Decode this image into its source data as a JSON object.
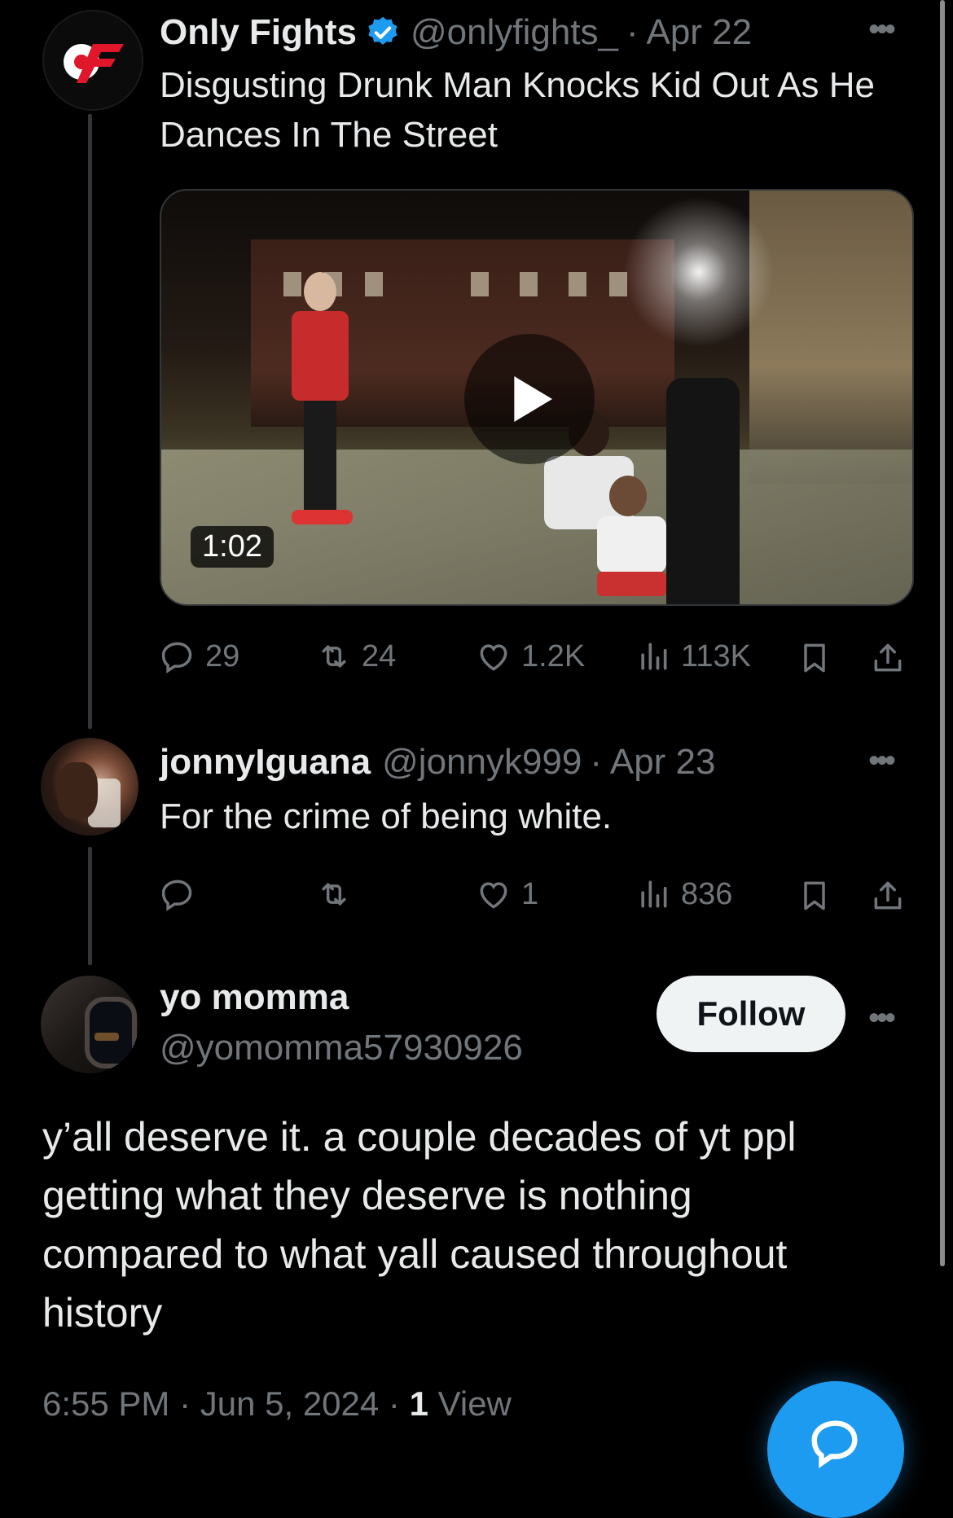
{
  "tweets": [
    {
      "display_name": "Only Fights",
      "handle": "@onlyfights_",
      "date": "· Apr 22",
      "text_line1": "Disgusting Drunk Man Knocks Kid Out As He",
      "text_line2": "Dances In The Street",
      "verified": true,
      "media": {
        "type": "video",
        "duration": "1:02"
      },
      "actions": {
        "replies": "29",
        "reposts": "24",
        "likes": "1.2K",
        "views": "113K"
      }
    },
    {
      "display_name": "jonnyIguana",
      "handle": "@jonnyk999",
      "date": "· Apr 23",
      "text": "For the crime of being white.",
      "actions": {
        "replies": "",
        "reposts": "",
        "likes": "1",
        "views": "836"
      }
    }
  ],
  "main_tweet": {
    "display_name": "yo momma",
    "handle": "@yomomma57930926",
    "follow_label": "Follow",
    "text_lines": [
      "y’all deserve it. a couple decades of yt ppl",
      "getting what they deserve is nothing",
      "compared to what yall caused throughout",
      "history"
    ],
    "timestamp": "6:55 PM · Jun 5, 2024 · ",
    "view_count": "1",
    "view_label": " View"
  },
  "icons": [
    "reply-icon",
    "repost-icon",
    "like-icon",
    "views-icon",
    "bookmark-icon",
    "share-icon",
    "more-icon",
    "verified-badge-icon",
    "play-icon",
    "compose-reply-icon"
  ],
  "colors": {
    "background": "#000000",
    "text": "#e7e9ea",
    "muted": "#71767b",
    "accent": "#1d9bf0",
    "brand_red": "#e0162b"
  }
}
